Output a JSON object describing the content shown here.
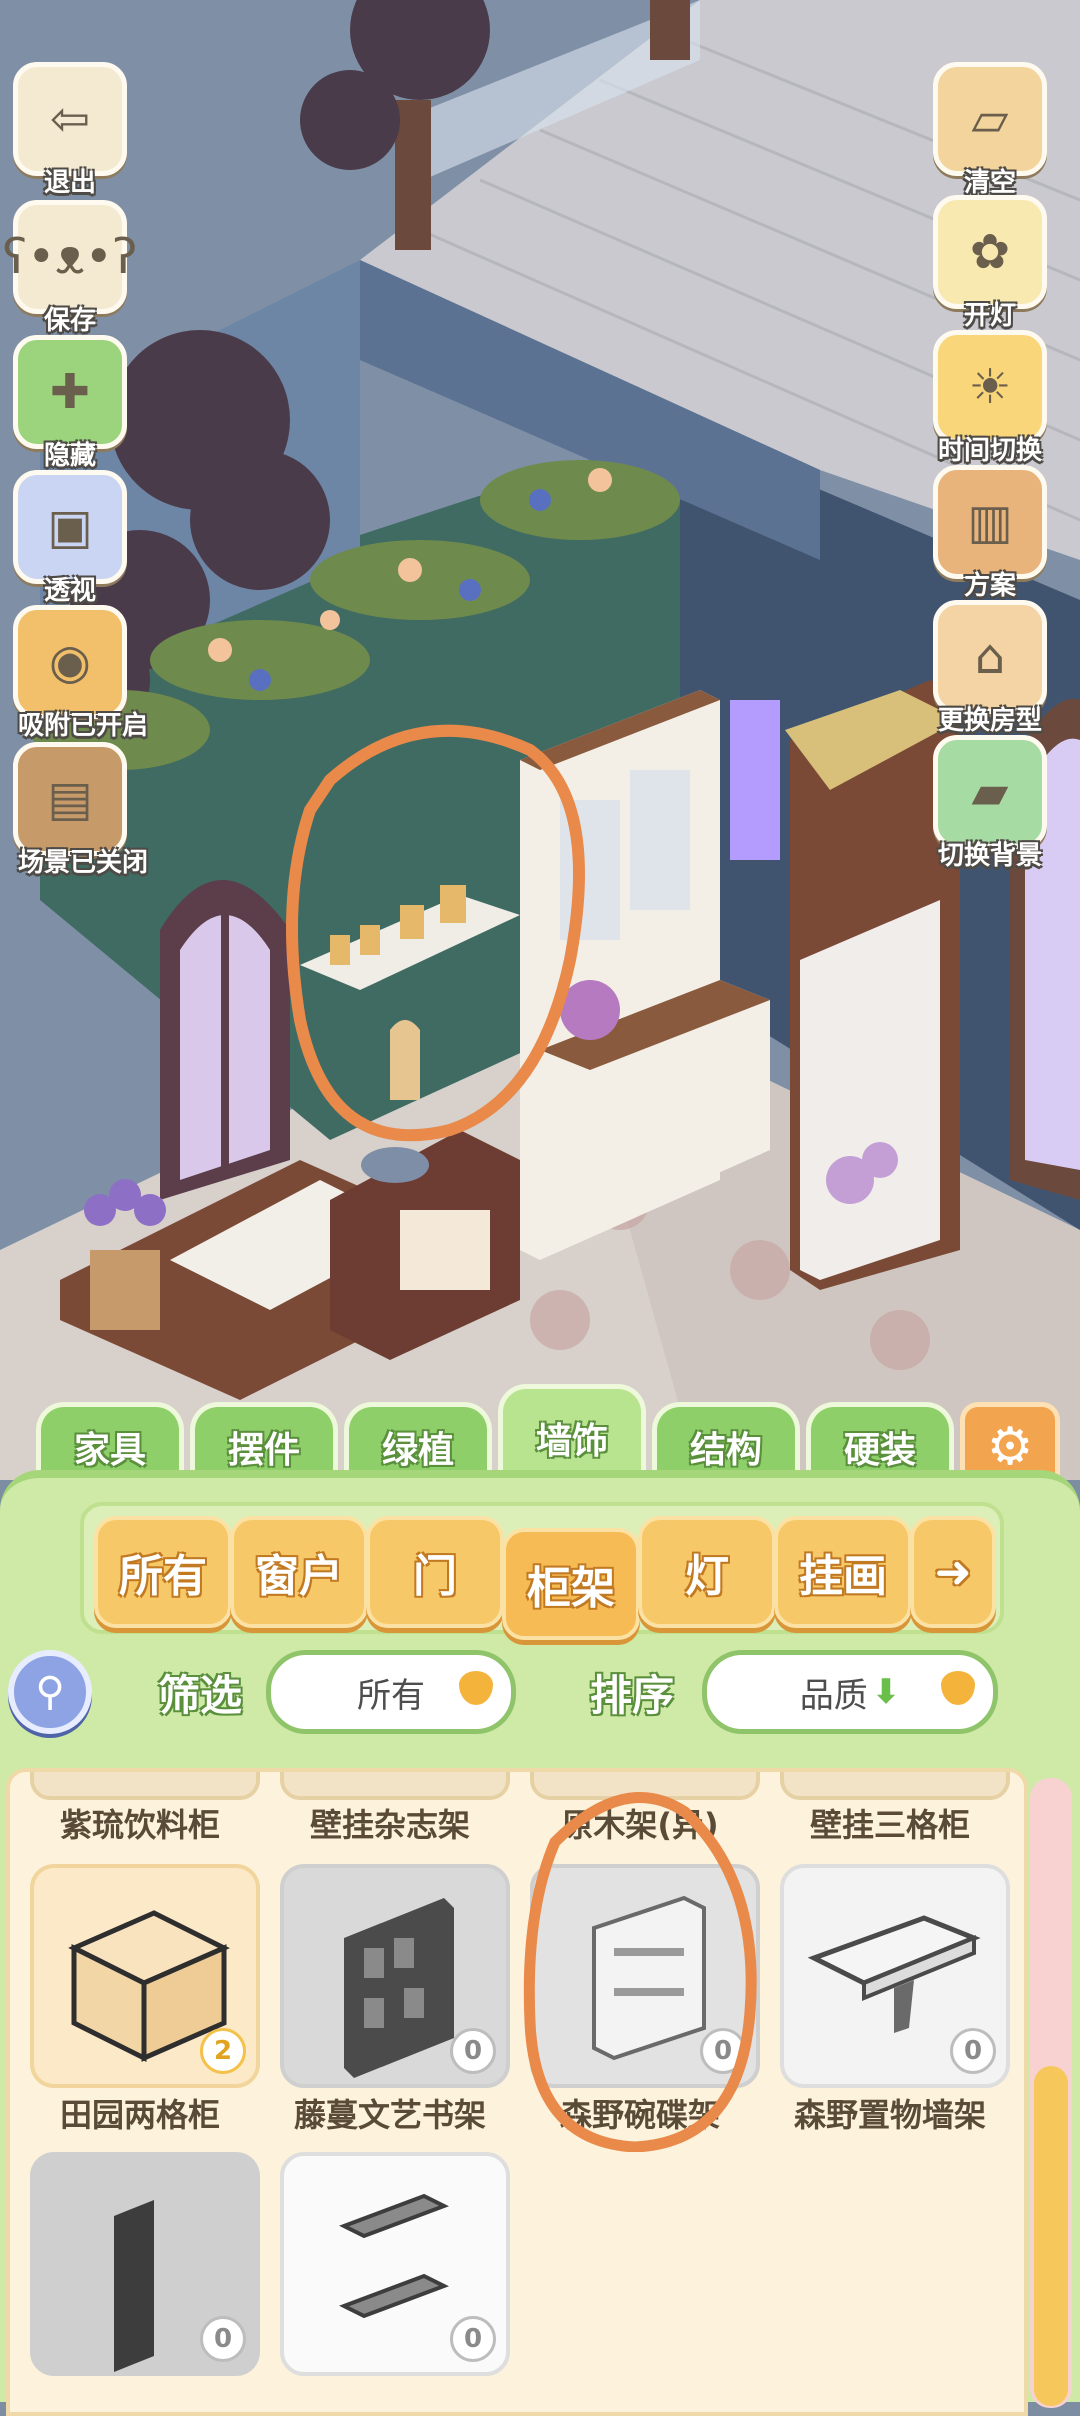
{
  "left_tools": [
    {
      "label": "退出",
      "icon": "exit-arrow-icon"
    },
    {
      "label": "保存",
      "icon": "hamster-save-icon"
    },
    {
      "label": "隐藏",
      "icon": "hide-icon"
    },
    {
      "label": "透视",
      "icon": "cube-xray-icon"
    },
    {
      "label": "吸附已开启",
      "icon": "snap-magnet-icon"
    },
    {
      "label": "场景已关闭",
      "icon": "scene-toggle-icon"
    }
  ],
  "right_tools": [
    {
      "label": "清空",
      "icon": "clear-box-icon"
    },
    {
      "label": "开灯",
      "icon": "lightbulb-icon"
    },
    {
      "label": "时间切换",
      "icon": "sun-moon-icon"
    },
    {
      "label": "方案",
      "icon": "book-plan-icon"
    },
    {
      "label": "更换房型",
      "icon": "house-icon"
    },
    {
      "label": "切换背景",
      "icon": "background-icon"
    }
  ],
  "categories": [
    "家具",
    "摆件",
    "绿植",
    "墙饰",
    "结构",
    "硬装"
  ],
  "active_category": "墙饰",
  "subcategories": [
    "所有",
    "窗户",
    "门",
    "柜架",
    "灯",
    "挂画"
  ],
  "active_subcategory": "柜架",
  "filter": {
    "label": "筛选",
    "value": "所有"
  },
  "sort": {
    "label": "排序",
    "value": "品质"
  },
  "items_row0": [
    {
      "name": "紫琉饮料柜"
    },
    {
      "name": "壁挂杂志架"
    },
    {
      "name": "原木架(异)"
    },
    {
      "name": "壁挂三格柜"
    }
  ],
  "items_row1": [
    {
      "name": "田园两格柜",
      "count": "2"
    },
    {
      "name": "藤蔓文艺书架",
      "count": "0"
    },
    {
      "name": "森野碗碟架",
      "count": "0"
    },
    {
      "name": "森野置物墙架",
      "count": "0"
    }
  ],
  "items_row2": [
    {
      "name": "",
      "count": "0"
    },
    {
      "name": "",
      "count": "0"
    }
  ],
  "colors": {
    "panel_green": "#cfeaa6",
    "tab_orange": "#f7c868",
    "annotation_orange": "#e9894a"
  }
}
